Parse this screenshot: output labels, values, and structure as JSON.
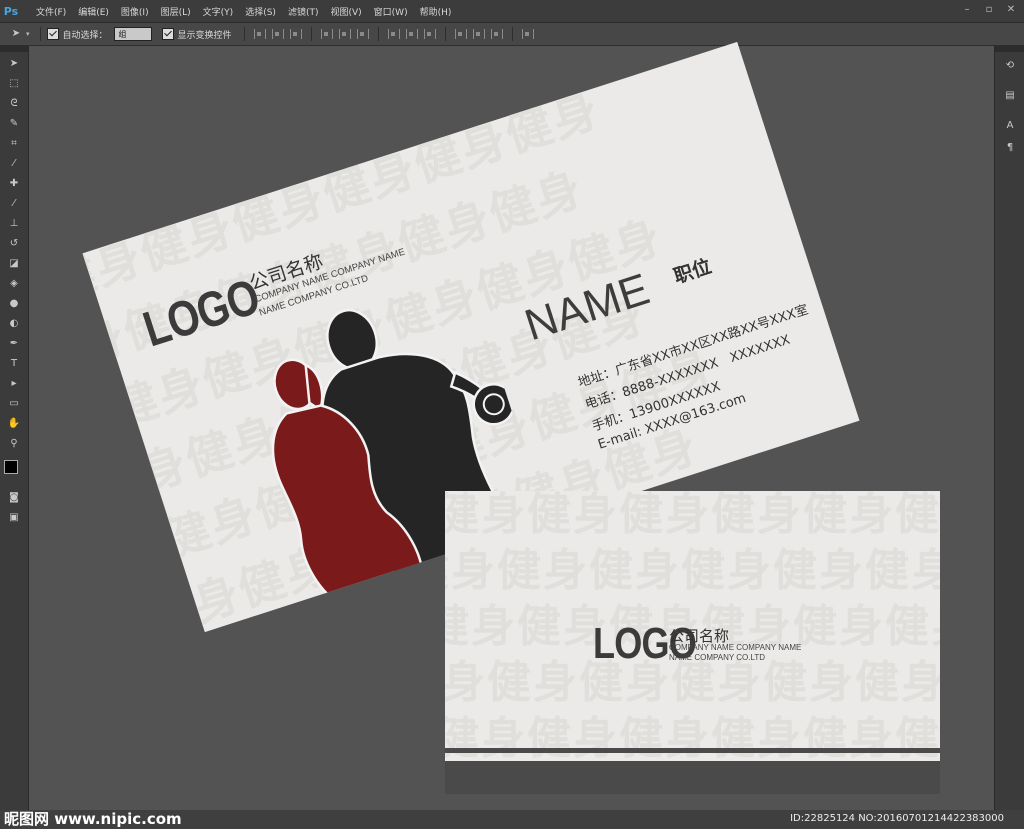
{
  "app": {
    "logo_text": "Ps"
  },
  "menu": [
    "文件(F)",
    "编辑(E)",
    "图像(I)",
    "图层(L)",
    "文字(Y)",
    "选择(S)",
    "滤镜(T)",
    "视图(V)",
    "窗口(W)",
    "帮助(H)"
  ],
  "window_controls": [
    "–",
    "▫",
    "✕"
  ],
  "options_bar": {
    "auto_select_label": "自动选择：",
    "auto_select_value": "组",
    "show_transform_label": "显示变换控件"
  },
  "front_card": {
    "logo": "LOGO",
    "company_name": "公司名称",
    "company_sub_1": "COMPANY NAME COMPANY NAME",
    "company_sub_2": "NAME COMPANY CO.LTD",
    "person_name": "NAME",
    "position": "职位",
    "address": "地址：广东省XX市XX区XX路XX号XXX室",
    "phone": "电话：8888-XXXXXXX　XXXXXXX",
    "mobile": "手机：13900XXXXXX",
    "email": "E-mail: XXXX@163.com",
    "watermark": "健身健身健身健身健身健身",
    "colors": {
      "woman": "#7a1a1a",
      "man": "#252525"
    }
  },
  "back_card": {
    "logo": "LOGO",
    "company_name": "公司名称",
    "company_sub_1": "COMPANY NAME COMPANY NAME",
    "company_sub_2": "NAME COMPANY CO.LTD",
    "watermark": "健身健身健身健身健身健身"
  },
  "footer": {
    "brand": "昵图网 www.nipic.com",
    "id_text": "ID:22825124 NO:20160701214422383000"
  }
}
